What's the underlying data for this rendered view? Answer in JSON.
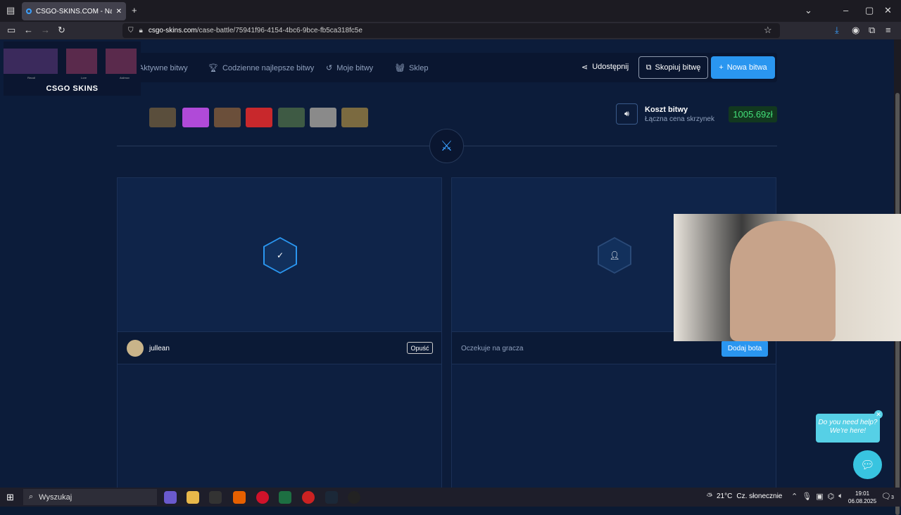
{
  "browser": {
    "tab_title": "CSGO-SKINS.COM - Najlepsze",
    "url_domain": "csgo-skins.com",
    "url_path": "/case-battle/75941f96-4154-4bc6-9bce-fb5ca318fc5e"
  },
  "nav": {
    "items": [
      "Aktywne bitwy",
      "Codzienne najlepsze bitwy",
      "Moje bitwy",
      "Sklep"
    ],
    "share_label": "Udostępnij",
    "copy_label": "Skopiuj bitwę",
    "new_label": "Nowa bitwa"
  },
  "logo": {
    "text": "CSGO SKINS",
    "items": [
      "Recoil",
      "Lore",
      "Asiimov"
    ]
  },
  "cases": {
    "colors": [
      "#5a4e3c",
      "#b04ad8",
      "#6b4f3a",
      "#c8282c",
      "#3e5a44",
      "#8a8a8a",
      "#7b6a40"
    ]
  },
  "cost": {
    "title": "Koszt bitwy",
    "subtitle": "Łączna cena skrzynek",
    "value": "1005.69zł"
  },
  "player1": {
    "name": "jullean",
    "leave_label": "Opuść"
  },
  "player2": {
    "status": "Oczekuje na gracza",
    "add_bot_label": "Dodaj bota"
  },
  "help": {
    "line1": "Do you need help?",
    "line2": "We're here!"
  },
  "taskbar": {
    "search_placeholder": "Wyszukaj",
    "weather": "21°C",
    "weather_desc": "Cz. słonecznie",
    "time": "19:01",
    "date": "06.08.2025",
    "notif_count": "3"
  }
}
